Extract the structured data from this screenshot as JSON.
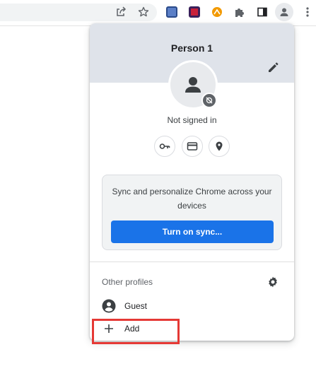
{
  "toolbar": {
    "share_icon": "share-icon",
    "bookmark_icon": "star-icon",
    "extensions": [
      "extension-1-icon",
      "extension-2-icon",
      "extension-3-icon"
    ],
    "puzzle_icon": "puzzle-icon",
    "side_panel_icon": "side-panel-icon",
    "profile_icon": "profile-icon",
    "menu_icon": "more-vert-icon"
  },
  "profile_menu": {
    "name": "Person 1",
    "status": "Not signed in",
    "quick_actions": [
      "key-icon",
      "credit-card-icon",
      "location-icon"
    ],
    "sync_promo": {
      "text": "Sync and personalize Chrome across your devices",
      "button_label": "Turn on sync..."
    },
    "other_profiles": {
      "heading": "Other profiles",
      "items": [
        {
          "label": "Guest",
          "icon": "guest-avatar-icon"
        },
        {
          "label": "Add",
          "icon": "plus-icon"
        }
      ]
    }
  },
  "colors": {
    "accent": "#1a73e8",
    "header_bg": "#dfe3ea",
    "highlight": "#e53935"
  }
}
